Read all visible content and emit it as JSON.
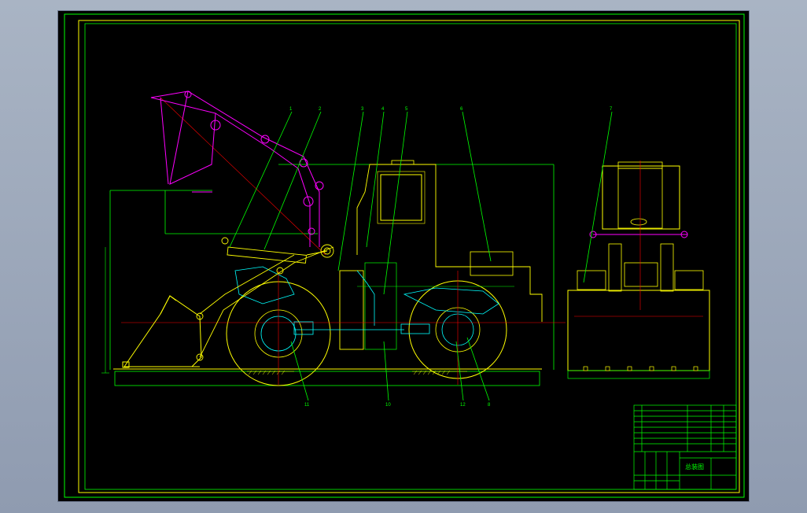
{
  "drawing": {
    "background": "#000000",
    "colors": {
      "frame": "#00ff00",
      "inner_frame": "#ffff00",
      "vehicle": "#ffff00",
      "linkage": "#ff00ff",
      "hydraulics": "#00ffff",
      "leaders": "#00ff00",
      "centerlines": "#ff0000",
      "title_block": "#00ff00"
    },
    "part_numbers": {
      "top": [
        "1",
        "2",
        "3",
        "4",
        "5",
        "6",
        "7"
      ],
      "bottom": [
        "11",
        "10",
        "12",
        "8"
      ]
    },
    "title_block": {
      "drawing_title": "总装图"
    }
  }
}
